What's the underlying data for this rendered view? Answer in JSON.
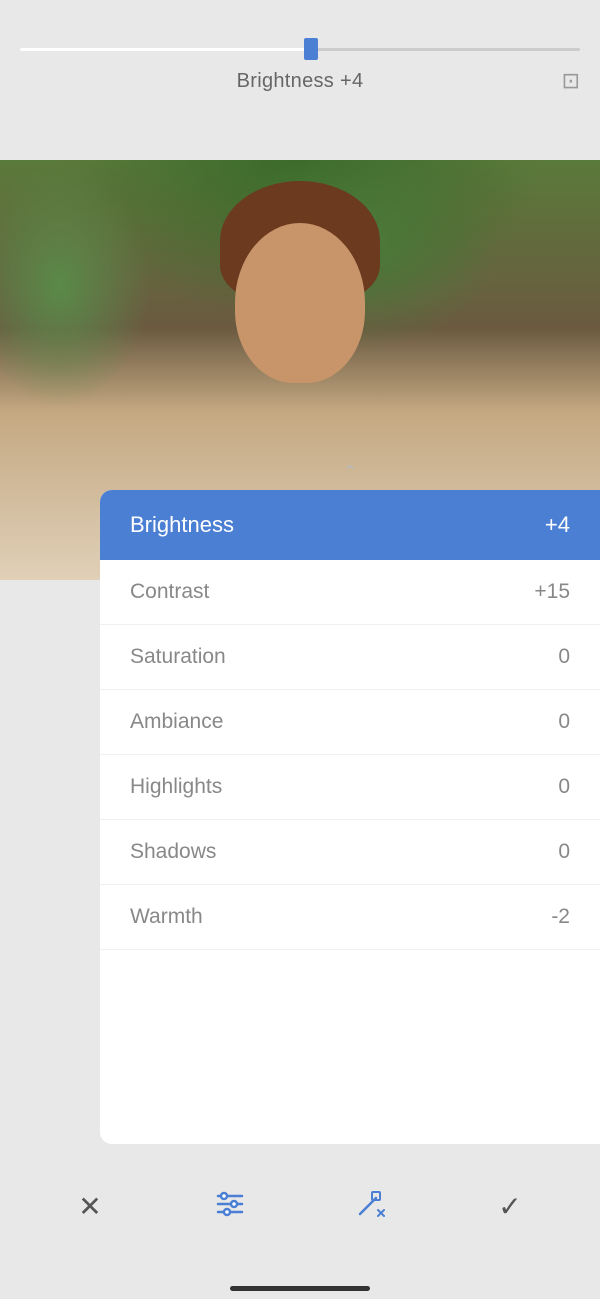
{
  "slider": {
    "label": "Brightness",
    "value": "+4",
    "label_value": "Brightness +4",
    "percent": 52
  },
  "compare_icon": "⊡",
  "panel": {
    "rows": [
      {
        "label": "Brightness",
        "value": "+4",
        "selected": true
      },
      {
        "label": "Contrast",
        "value": "+15",
        "selected": false
      },
      {
        "label": "Saturation",
        "value": "0",
        "selected": false
      },
      {
        "label": "Ambiance",
        "value": "0",
        "selected": false
      },
      {
        "label": "Highlights",
        "value": "0",
        "selected": false
      },
      {
        "label": "Shadows",
        "value": "0",
        "selected": false
      },
      {
        "label": "Warmth",
        "value": "-2",
        "selected": false
      }
    ]
  },
  "toolbar": {
    "cancel_label": "×",
    "check_label": "✓"
  },
  "colors": {
    "accent": "#4a7fd4",
    "selected_bg": "#4a7fd4",
    "panel_bg": "#ffffff",
    "app_bg": "#e8e8e8"
  }
}
